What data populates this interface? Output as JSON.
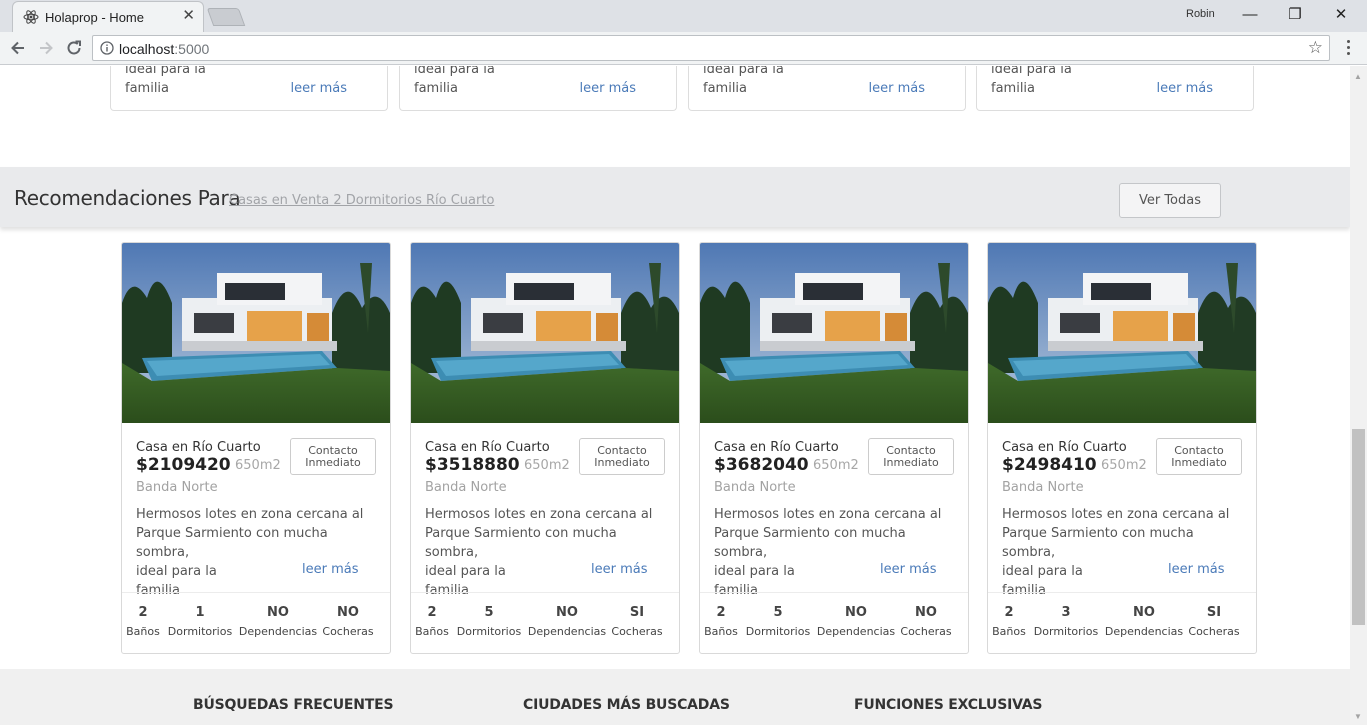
{
  "browser": {
    "tab_title": "Holaprop - Home",
    "tab_close": "✕",
    "profile_name": "Robin",
    "url_host": "localhost",
    "url_port": ":5000",
    "window_controls": [
      "—",
      "❐",
      "✕"
    ]
  },
  "top_cards": [
    {
      "line1": "ideal para la",
      "line2": "familia",
      "more": "leer más"
    },
    {
      "line1": "ideal para la",
      "line2": "familia",
      "more": "leer más"
    },
    {
      "line1": "ideal para la",
      "line2": "familia",
      "more": "leer más"
    },
    {
      "line1": "ideal para la",
      "line2": "familia",
      "more": "leer más"
    }
  ],
  "recommendations": {
    "title": "Recomendaciones Para",
    "filter_link": "Casas en Venta 2 Dormitorios Río Cuarto",
    "see_all": "Ver Todas"
  },
  "cards": [
    {
      "type": "Casa en Río Cuarto",
      "price": "$2109420",
      "area": "650m2",
      "contact_line1": "Contacto",
      "contact_line2": "Inmediato",
      "zone": "Banda Norte",
      "desc": [
        "Hermosos lotes en zona cercana al",
        "Parque Sarmiento con mucha sombra,",
        "ideal para la",
        "familia"
      ],
      "more": "leer más",
      "features": [
        {
          "value": "2",
          "label": "Baños"
        },
        {
          "value": "1",
          "label": "Dormitorios"
        },
        {
          "value": "NO",
          "label": "Dependencias"
        },
        {
          "value": "NO",
          "label": "Cocheras"
        }
      ]
    },
    {
      "type": "Casa en Río Cuarto",
      "price": "$3518880",
      "area": "650m2",
      "contact_line1": "Contacto",
      "contact_line2": "Inmediato",
      "zone": "Banda Norte",
      "desc": [
        "Hermosos lotes en zona cercana al",
        "Parque Sarmiento con mucha sombra,",
        "ideal para la",
        "familia"
      ],
      "more": "leer más",
      "features": [
        {
          "value": "2",
          "label": "Baños"
        },
        {
          "value": "5",
          "label": "Dormitorios"
        },
        {
          "value": "NO",
          "label": "Dependencias"
        },
        {
          "value": "SI",
          "label": "Cocheras"
        }
      ]
    },
    {
      "type": "Casa en Río Cuarto",
      "price": "$3682040",
      "area": "650m2",
      "contact_line1": "Contacto",
      "contact_line2": "Inmediato",
      "zone": "Banda Norte",
      "desc": [
        "Hermosos lotes en zona cercana al",
        "Parque Sarmiento con mucha sombra,",
        "ideal para la",
        "familia"
      ],
      "more": "leer más",
      "features": [
        {
          "value": "2",
          "label": "Baños"
        },
        {
          "value": "5",
          "label": "Dormitorios"
        },
        {
          "value": "NO",
          "label": "Dependencias"
        },
        {
          "value": "NO",
          "label": "Cocheras"
        }
      ]
    },
    {
      "type": "Casa en Río Cuarto",
      "price": "$2498410",
      "area": "650m2",
      "contact_line1": "Contacto",
      "contact_line2": "Inmediato",
      "zone": "Banda Norte",
      "desc": [
        "Hermosos lotes en zona cercana al",
        "Parque Sarmiento con mucha sombra,",
        "ideal para la",
        "familia"
      ],
      "more": "leer más",
      "features": [
        {
          "value": "2",
          "label": "Baños"
        },
        {
          "value": "3",
          "label": "Dormitorios"
        },
        {
          "value": "NO",
          "label": "Dependencias"
        },
        {
          "value": "SI",
          "label": "Cocheras"
        }
      ]
    }
  ],
  "footer": {
    "col1": "BÚSQUEDAS FRECUENTES",
    "col2": "CIUDADES MÁS BUSCADAS",
    "col3": "FUNCIONES EXCLUSIVAS"
  }
}
